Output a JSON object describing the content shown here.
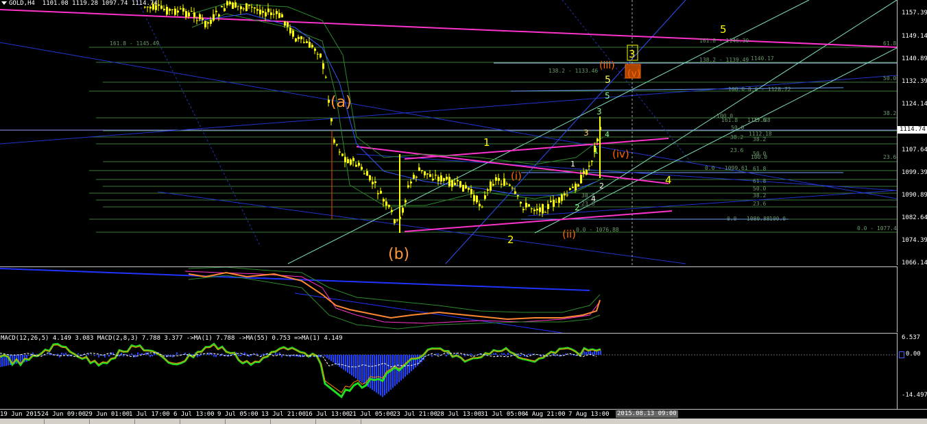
{
  "chart_header": {
    "symbol": "GOLD,H4",
    "ohlc": "1101.08 1119.28 1097.74 1114.74"
  },
  "price_axis": {
    "ticks": [
      "1157.39",
      "1149.14",
      "1140.89",
      "1132.39",
      "1124.14",
      "1115.89",
      "1107.64",
      "1099.39",
      "1090.89",
      "1082.64",
      "1074.39",
      "1066.14"
    ],
    "current_price": "1114.74"
  },
  "osc_axis": {
    "ticks": []
  },
  "macd_axis": {
    "ticks": [
      "6.537",
      "0.00",
      "-14.497"
    ]
  },
  "macd_header": "MACD(12,26,5) 4.149 3.083  MACD(2,8,3) 7.788 3.377  ->MA(1) 7.788  ->MA(55) 0.753  =>MA(1) 4.149",
  "time_axis": {
    "labels": [
      "19 Jun 2015",
      "24 Jun 09:00",
      "29 Jun 01:00",
      "1 Jul 17:00",
      "6 Jul 13:00",
      "9 Jul 05:00",
      "13 Jul 21:00",
      "16 Jul 13:00",
      "21 Jul 05:00",
      "23 Jul 21:00",
      "28 Jul 13:00",
      "31 Jul 05:00",
      "4 Aug 21:00",
      "7 Aug 13:00"
    ],
    "cursor_label": "2015.08.13 09:00"
  },
  "wave_labels": [
    {
      "text": "(a)",
      "color": "#ff9933"
    },
    {
      "text": "(b)",
      "color": "#ff9933"
    },
    {
      "text": "1",
      "color": "#ffff00"
    },
    {
      "text": "2",
      "color": "#ffff00"
    },
    {
      "text": "4",
      "color": "#ffff00"
    },
    {
      "text": "5",
      "color": "#ffff00"
    },
    {
      "text": "(i)",
      "color": "#ff6600"
    },
    {
      "text": "(ii)",
      "color": "#ff6600"
    },
    {
      "text": "(iii)",
      "color": "#ff6600"
    },
    {
      "text": "(iv)",
      "color": "#ff6600"
    },
    {
      "text": "(v)",
      "color": "#ff6600"
    },
    {
      "text": "3",
      "color": "#ffff00"
    },
    {
      "text": "5",
      "color": "#ffff66"
    },
    {
      "text": "5",
      "color": "#80ff80"
    },
    {
      "text": "3",
      "color": "#80ff80"
    },
    {
      "text": "4",
      "color": "#80ff80"
    },
    {
      "text": "3",
      "color": "#ffcc66"
    },
    {
      "text": "1",
      "color": "#ffffff"
    },
    {
      "text": "1",
      "color": "#80ff80"
    },
    {
      "text": "2",
      "color": "#80ff80"
    },
    {
      "text": "2",
      "color": "#ffffff"
    },
    {
      "text": "4",
      "color": "#ffffff"
    }
  ],
  "fib_labels": [
    "161.8 - 1145.49",
    "161.8 - 1146.30",
    "138.2 - 1139.49",
    "1140.17",
    "138.2 - 1133.46",
    "100.0  0.0 - 1128.72",
    "100.0",
    "161.8",
    "1117.88",
    "50.0",
    "23.6",
    "38.2",
    "1112.18",
    "38.2",
    "23.6",
    "50.0",
    "100.0",
    "0.0 - 1099.61",
    "61.8",
    "61.8",
    "50.0",
    "38.2",
    "23.6",
    "38.2",
    "23.6",
    "0.0 - 1080.88",
    "100.0",
    "0.0 - 1076.88",
    "0.0 - 1077.40",
    "61.8",
    "50.0",
    "38.2",
    "23.6"
  ],
  "colors": {
    "background": "#000000",
    "candle": "#ffff00",
    "magenta": "#ff33cc",
    "blue": "#2233cc",
    "teal": "#80e0c0",
    "fib_green": "#3a7a3a",
    "macd_green": "#22dd22",
    "macd_hist": "#2244ff",
    "osc_orange": "#ff8833"
  }
}
